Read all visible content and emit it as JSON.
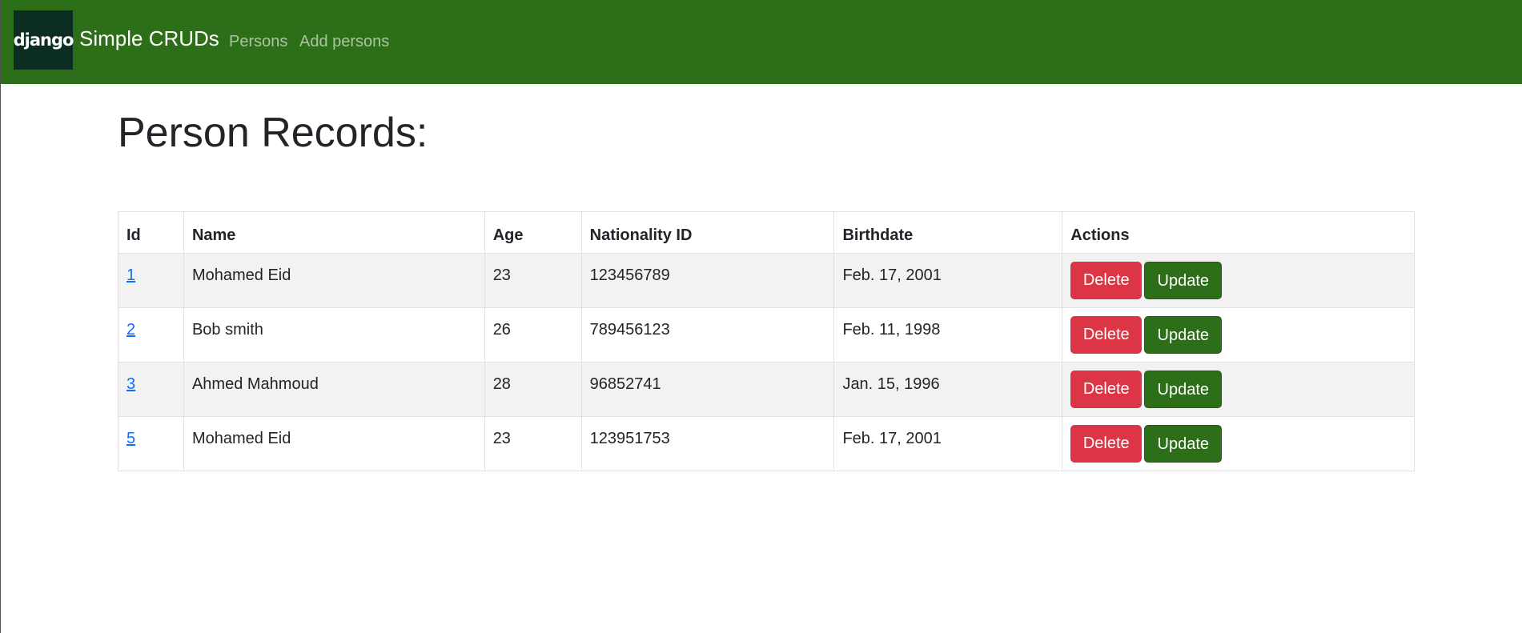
{
  "navbar": {
    "logo_text": "django",
    "brand": "Simple CRUDs",
    "links": [
      {
        "label": "Persons"
      },
      {
        "label": "Add persons"
      }
    ]
  },
  "page": {
    "title": "Person Records:"
  },
  "table": {
    "headers": [
      "Id",
      "Name",
      "Age",
      "Nationality ID",
      "Birthdate",
      "Actions"
    ],
    "rows": [
      {
        "id": "1",
        "name": "Mohamed Eid",
        "age": "23",
        "nationality_id": "123456789",
        "birthdate": "Feb. 17, 2001"
      },
      {
        "id": "2",
        "name": "Bob smith",
        "age": "26",
        "nationality_id": "789456123",
        "birthdate": "Feb. 11, 1998"
      },
      {
        "id": "3",
        "name": "Ahmed Mahmoud",
        "age": "28",
        "nationality_id": "96852741",
        "birthdate": "Jan. 15, 1996"
      },
      {
        "id": "5",
        "name": "Mohamed Eid",
        "age": "23",
        "nationality_id": "123951753",
        "birthdate": "Feb. 17, 2001"
      }
    ],
    "delete_label": "Delete",
    "update_label": "Update"
  },
  "colors": {
    "navbar": "#2d6e19",
    "logo_bg": "#0c2e22",
    "delete": "#dc3545",
    "update": "#2d6e19",
    "link": "#0d6efd",
    "stripe": "#f2f2f2"
  }
}
